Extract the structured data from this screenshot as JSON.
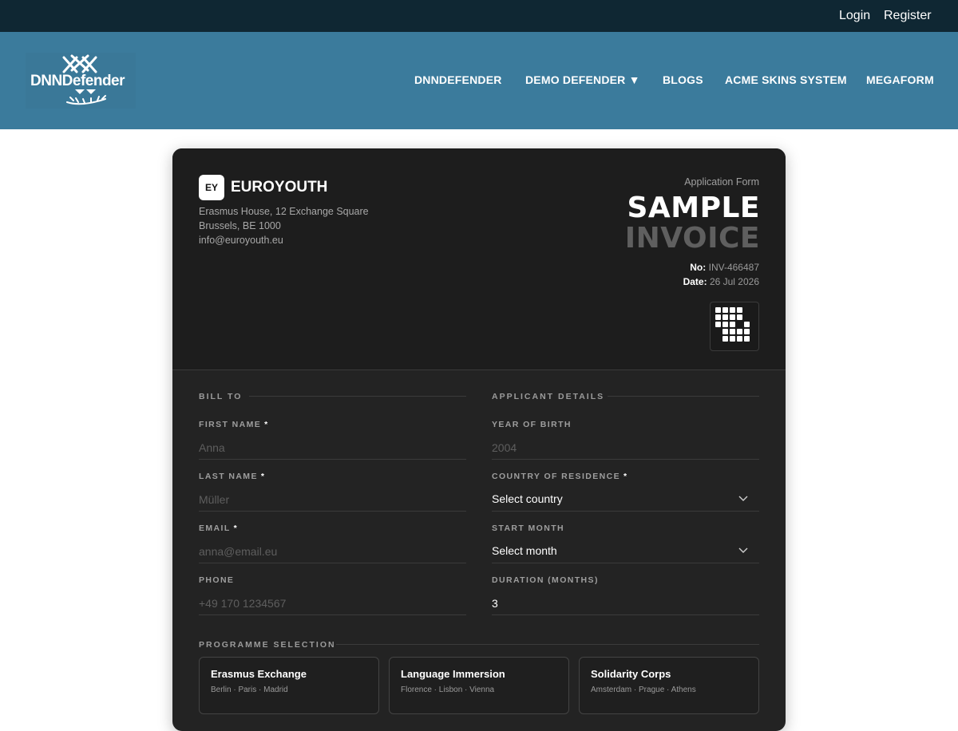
{
  "topbar": {
    "login": "Login",
    "register": "Register"
  },
  "brand": {
    "logo_text": "DNNDefender"
  },
  "nav": [
    {
      "label": "DNNDEFENDER"
    },
    {
      "label": "DEMO DEFENDER ▼"
    },
    {
      "label": "BLOGS"
    },
    {
      "label": "ACME SKINS SYSTEM"
    },
    {
      "label": "MEGAFORM"
    }
  ],
  "org": {
    "badge": "EY",
    "name": "EUROYOUTH",
    "address1": "Erasmus House, 12 Exchange Square",
    "address2": "Brussels, BE 1000",
    "email": "info@euroyouth.eu"
  },
  "invoice": {
    "kind": "Application Form",
    "title_line1": "SAMPLE",
    "title_line2": "INVOICE",
    "number_label": "No:",
    "number": "INV-466487",
    "date_label": "Date:",
    "date": "26 Jul 2026"
  },
  "bill_to": {
    "title": "BILL TO",
    "first_name": {
      "label": "FIRST NAME",
      "required": "*",
      "placeholder": "Anna"
    },
    "last_name": {
      "label": "LAST NAME",
      "required": "*",
      "placeholder": "Müller"
    },
    "email": {
      "label": "EMAIL",
      "required": "*",
      "placeholder": "anna@email.eu"
    },
    "phone": {
      "label": "PHONE",
      "placeholder": "+49 170 1234567"
    }
  },
  "applicant": {
    "title": "APPLICANT DETAILS",
    "year_of_birth": {
      "label": "YEAR OF BIRTH",
      "placeholder": "2004"
    },
    "country": {
      "label": "COUNTRY OF RESIDENCE",
      "required": "*",
      "value": "Select country"
    },
    "start_month": {
      "label": "START MONTH",
      "value": "Select month"
    },
    "duration": {
      "label": "DURATION (MONTHS)",
      "value": "3"
    }
  },
  "programme": {
    "title": "PROGRAMME SELECTION",
    "options": [
      {
        "name": "Erasmus Exchange",
        "cities": "Berlin · Paris · Madrid"
      },
      {
        "name": "Language Immersion",
        "cities": "Florence · Lisbon · Vienna"
      },
      {
        "name": "Solidarity Corps",
        "cities": "Amsterdam · Prague · Athens"
      }
    ]
  }
}
